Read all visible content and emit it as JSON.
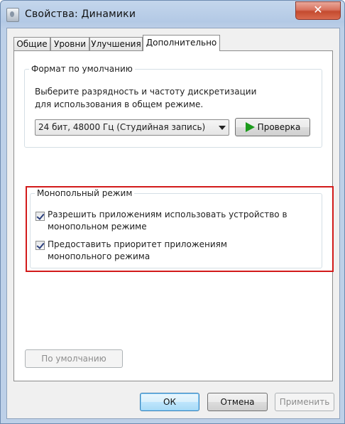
{
  "window": {
    "title": "Свойства: Динамики",
    "close_glyph": "✕"
  },
  "tabs": [
    {
      "label": "Общие"
    },
    {
      "label": "Уровни"
    },
    {
      "label": "Улучшения"
    },
    {
      "label": "Дополнительно",
      "active": true
    }
  ],
  "default_format": {
    "legend": "Формат по умолчанию",
    "description": "Выберите разрядность и частоту дискретизации для использования в общем режиме.",
    "selected_format": "24 бит, 48000 Гц (Студийная запись)",
    "test_button_label": "Проверка"
  },
  "exclusive_mode": {
    "legend": "Монопольный режим",
    "options": [
      {
        "label": "Разрешить приложениям использовать устройство в монопольном режиме",
        "checked": true
      },
      {
        "label": "Предоставить приоритет приложениям монопольного режима",
        "checked": true
      }
    ]
  },
  "restore_defaults_label": "По умолчанию",
  "footer": {
    "ok_label": "ОК",
    "cancel_label": "Отмена",
    "apply_label": "Применить"
  },
  "colors": {
    "highlight_border": "#d21a1a",
    "play_icon": "#1c9b1c",
    "close_button": "#c44a2f"
  }
}
